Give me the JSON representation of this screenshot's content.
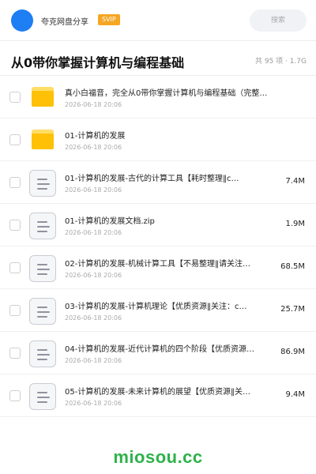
{
  "header": {
    "share_title": "夸克网盘分享",
    "badge": "SVIP",
    "search_label": "搜索"
  },
  "page": {
    "title": "从0带你掌握计算机与编程基础",
    "summary": "共 95 项 · 1.7G"
  },
  "items": [
    {
      "type": "folder",
      "name": "真小白福音，完全从0带你掌握计算机与编程基础（完整…",
      "date": "2026-06-18 20:06",
      "size": ""
    },
    {
      "type": "folder",
      "name": "01-计算机的发展",
      "date": "2026-06-18 20:06",
      "size": ""
    },
    {
      "type": "file",
      "name": "01-计算机的发展-古代的计算工具【耗时整理‖c…",
      "date": "2026-06-18 20:06",
      "size": "7.4M"
    },
    {
      "type": "file",
      "name": "01-计算机的发展文档.zip",
      "date": "2026-06-18 20:06",
      "size": "1.9M"
    },
    {
      "type": "file",
      "name": "02-计算机的发展-机械计算工具【不易整理‖请关注…",
      "date": "2026-06-18 20:06",
      "size": "68.5M"
    },
    {
      "type": "file",
      "name": "03-计算机的发展-计算机理论【优质资源‖关注：c…",
      "date": "2026-06-18 20:06",
      "size": "25.7M"
    },
    {
      "type": "file",
      "name": "04-计算机的发展-近代计算机的四个阶段【优质资源…",
      "date": "2026-06-18 20:06",
      "size": "86.9M"
    },
    {
      "type": "file",
      "name": "05-计算机的发展-未来计算机的展望【优质资源‖关…",
      "date": "2026-06-18 20:06",
      "size": "9.4M"
    }
  ],
  "icons": {
    "folder": "folder-icon",
    "file": "document-icon"
  },
  "colors": {
    "brand": "#1e7ef4",
    "svip": "#f5a623",
    "folder": "#ffc107",
    "watermark": "#2eb24a"
  },
  "watermark": "miosou.cc"
}
